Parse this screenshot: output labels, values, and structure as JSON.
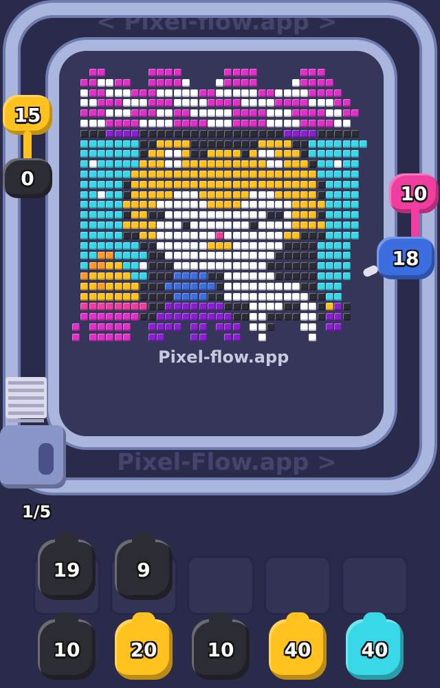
{
  "watermarks": {
    "top": "< Pixel-flow.app >",
    "bottom": "Pixel-Flow.app >",
    "board": "Pixel-flow.app"
  },
  "level_counter": "1/5",
  "colors": {
    "black": "#2c2c34",
    "yellow": "#ffc21f",
    "pink": "#ef3e9f",
    "blue": "#3c6ee0",
    "cyan": "#39d8e8",
    "white": "#ffffff",
    "purple": "#8a1fd0",
    "magenta": "#e030c8"
  },
  "track_shooters": [
    {
      "name": "left-yellow",
      "color": "yellow",
      "count": "15"
    },
    {
      "name": "left-black",
      "color": "black",
      "count": "0"
    },
    {
      "name": "right-pink",
      "color": "pink",
      "count": "10"
    },
    {
      "name": "right-blue",
      "color": "blue",
      "count": "18"
    }
  ],
  "queue_top": [
    {
      "color": "black",
      "count": "19"
    },
    {
      "color": "black",
      "count": "9"
    },
    {
      "color": "empty",
      "count": ""
    },
    {
      "color": "empty",
      "count": ""
    },
    {
      "color": "empty",
      "count": ""
    }
  ],
  "queue_bottom": [
    {
      "color": "black",
      "count": "10"
    },
    {
      "color": "yellow",
      "count": "20"
    },
    {
      "color": "black",
      "count": "10"
    },
    {
      "color": "yellow",
      "count": "40"
    },
    {
      "color": "cyan",
      "count": "40"
    }
  ]
}
